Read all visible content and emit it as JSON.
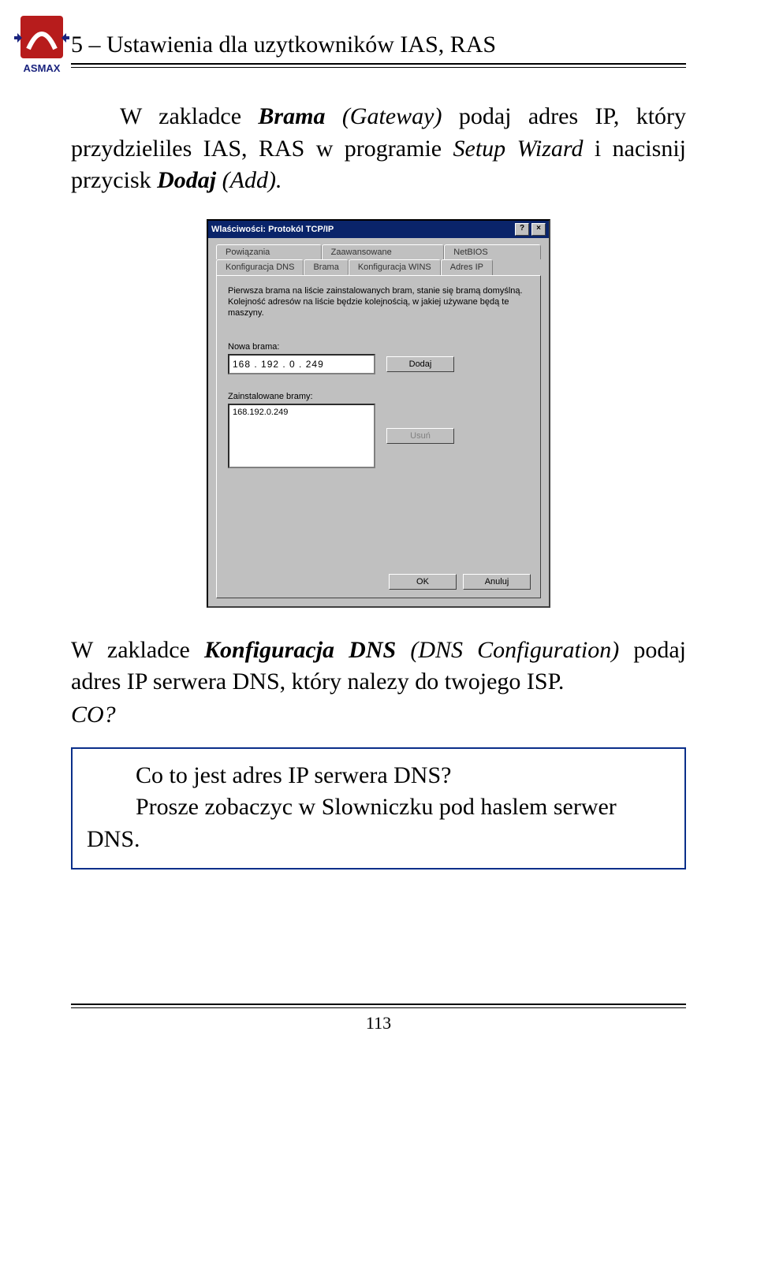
{
  "logo": {
    "brand": "ASMAX"
  },
  "heading": "5 – Ustawienia dla uzytkowników IAS, RAS",
  "para1": {
    "pre": "W zakladce ",
    "brama": "Brama",
    "gateway": " (Gateway) ",
    "mid": "podaj adres IP, który przydzieliles IAS, RAS w programie ",
    "setup": "Setup Wizard",
    "post": " i nacisnij przycisk ",
    "dodaj": "Dodaj",
    "add": " (Add)."
  },
  "dialog": {
    "title": "Wlaściwości: Protokól TCP/IP",
    "help_btn": "?",
    "close_btn": "×",
    "tabs_row1": [
      "Powiązania",
      "Zaawansowane",
      "NetBIOS"
    ],
    "tabs_row2": [
      "Konfiguracja DNS",
      "Brama",
      "Konfiguracja WINS",
      "Adres IP"
    ],
    "active_tab": "Brama",
    "description": "Pierwsza brama na liście zainstalowanych bram, stanie się bramą domyślną. Kolejność adresów na liście będzie kolejnością, w jakiej używane będą te maszyny.",
    "new_gateway_label": "Nowa brama:",
    "new_gateway_value": "168 . 192 .  0  . 249",
    "add_btn": "Dodaj",
    "installed_label": "Zainstalowane bramy:",
    "installed_item": "168.192.0.249",
    "remove_btn": "Usuń",
    "ok_btn": "OK",
    "cancel_btn": "Anuluj"
  },
  "para2": {
    "pre": "W zakladce ",
    "konf": "Konfiguracja DNS",
    "dns": " (DNS Configuration)",
    "post": " podaj adres IP serwera DNS, który nalezy do twojego ISP."
  },
  "co_label": "CO?",
  "callout": {
    "q": "Co to jest adres IP serwera DNS?",
    "a": "Prosze zobaczyc w Slowniczku pod haslem serwer DNS."
  },
  "page_number": "113"
}
